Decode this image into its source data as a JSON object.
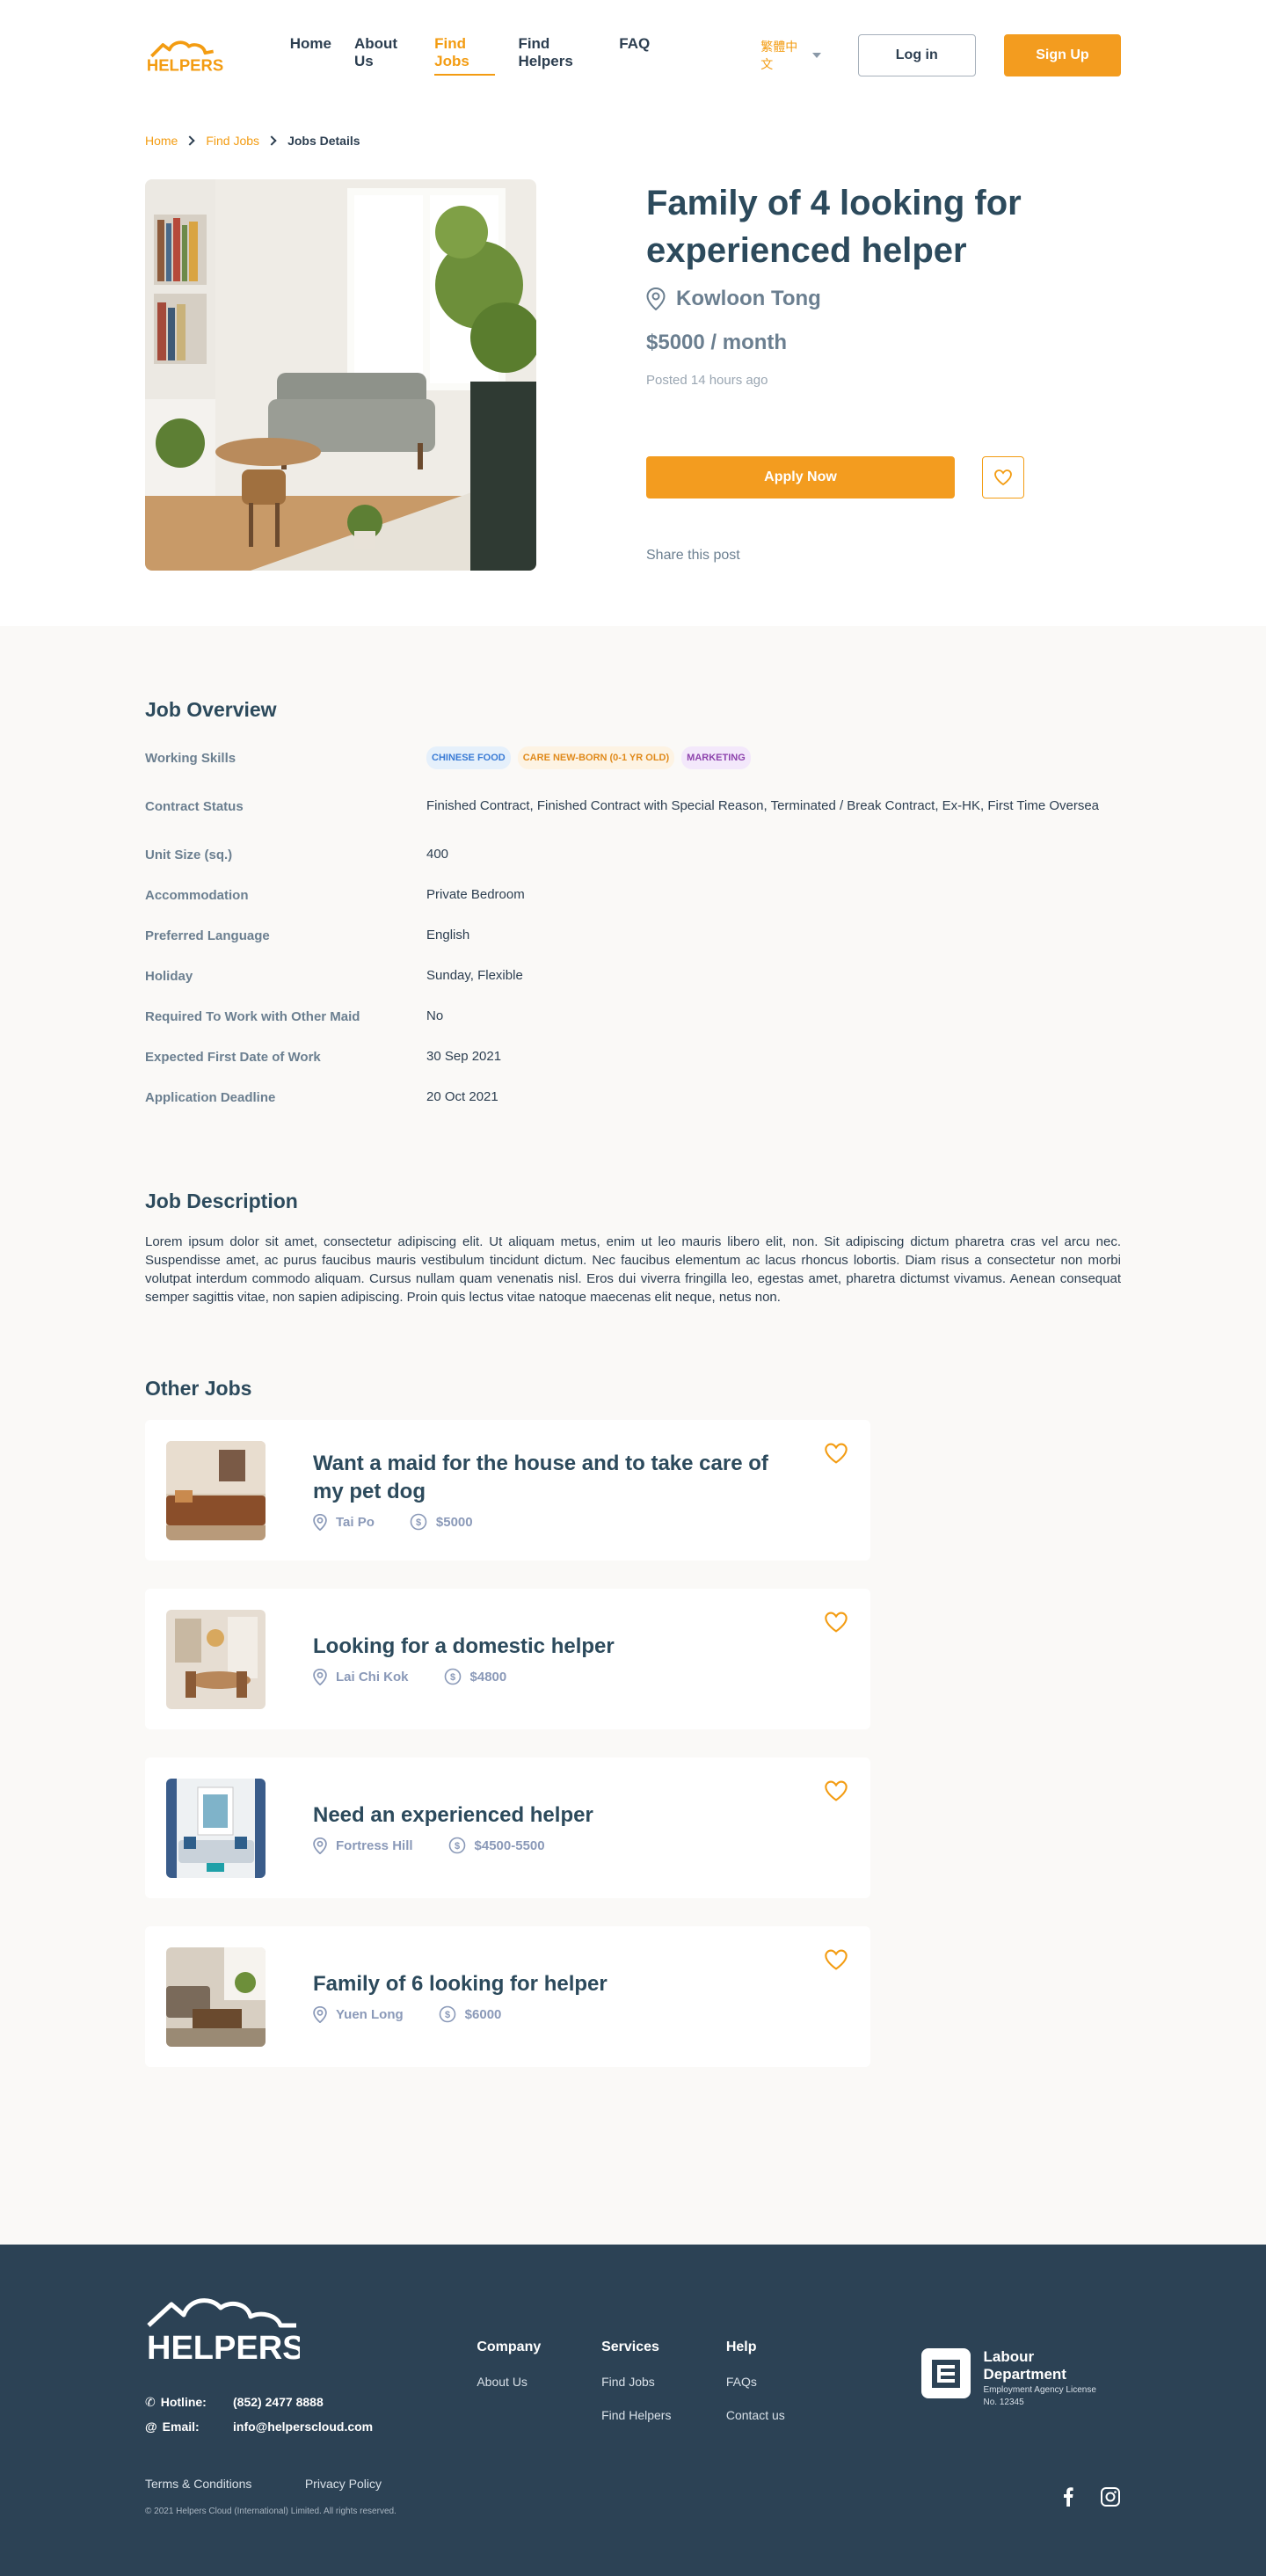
{
  "header": {
    "nav": [
      {
        "label": "Home",
        "active": false
      },
      {
        "label": "About Us",
        "active": false
      },
      {
        "label": "Find Jobs",
        "active": true
      },
      {
        "label": "Find Helpers",
        "active": false
      },
      {
        "label": "FAQ",
        "active": false
      }
    ],
    "language": "繁體中文",
    "login_label": "Log in",
    "signup_label": "Sign Up"
  },
  "breadcrumb": [
    "Home",
    "Find Jobs",
    "Jobs Details"
  ],
  "job": {
    "title": "Family of 4 looking for experienced helper",
    "location": "Kowloon Tong",
    "salary": "$5000 / month",
    "posted": "Posted 14 hours ago",
    "apply_label": "Apply Now",
    "share_label": "Share this post"
  },
  "overview": {
    "title": "Job Overview",
    "skills_label": "Working Skills",
    "skills": [
      "CHINESE FOOD",
      "CARE NEW-BORN (0-1 YR OLD)",
      "MARKETING"
    ],
    "rows": [
      {
        "label": "Contract Status",
        "value": "Finished Contract, Finished Contract with Special Reason, Terminated / Break Contract, Ex-HK, First Time Oversea"
      },
      {
        "label": "Unit Size (sq.)",
        "value": "400"
      },
      {
        "label": "Accommodation",
        "value": "Private Bedroom"
      },
      {
        "label": "Preferred Language",
        "value": "English"
      },
      {
        "label": "Holiday",
        "value": "Sunday, Flexible"
      },
      {
        "label": "Required To Work with Other Maid",
        "value": "No"
      },
      {
        "label": "Expected First Date of Work",
        "value": "30 Sep 2021"
      },
      {
        "label": "Application Deadline",
        "value": "20 Oct 2021"
      }
    ]
  },
  "description": {
    "title": "Job Description",
    "text": "Lorem ipsum dolor sit amet, consectetur adipiscing elit. Ut aliquam metus, enim ut leo mauris libero elit, non. Sit adipiscing dictum pharetra cras vel arcu nec. Suspendisse amet, ac purus faucibus mauris vestibulum tincidunt dictum. Nec faucibus elementum ac lacus rhoncus lobortis. Diam risus a consectetur non morbi volutpat interdum commodo aliquam. Cursus nullam quam venenatis nisl. Eros dui viverra fringilla leo, egestas amet, pharetra dictumst vivamus. Aenean consequat semper sagittis vitae, non sapien adipiscing. Proin quis lectus vitae natoque maecenas elit neque, netus non."
  },
  "other_jobs": {
    "title": "Other Jobs",
    "items": [
      {
        "title": "Want a maid for the house and to take care of my pet dog",
        "location": "Tai Po",
        "salary": "$5000"
      },
      {
        "title": "Looking for a domestic helper",
        "location": "Lai Chi Kok",
        "salary": "$4800"
      },
      {
        "title": "Need an experienced helper",
        "location": "Fortress Hill",
        "salary": "$4500-5500"
      },
      {
        "title": "Family of 6 looking for helper",
        "location": "Yuen Long",
        "salary": "$6000"
      }
    ]
  },
  "footer": {
    "hotline_label": "Hotline:",
    "hotline": "(852) 2477 8888",
    "email_label": "Email:",
    "email": "info@helperscloud.com",
    "columns": [
      {
        "title": "Company",
        "links": [
          "About Us"
        ]
      },
      {
        "title": "Services",
        "links": [
          "Find Jobs",
          "Find Helpers"
        ]
      },
      {
        "title": "Help",
        "links": [
          "FAQs",
          "Contact us"
        ]
      }
    ],
    "labour_title": "Labour Department",
    "labour_sub1": "Employment Agency License",
    "labour_sub2": "No. 12345",
    "terms": "Terms & Conditions",
    "privacy": "Privacy Policy",
    "copyright": "© 2021 Helpers Cloud (International) Limited. All rights reserved."
  },
  "colors": {
    "accent": "#f39c1f",
    "heading": "#2c4a5c",
    "footer_bg": "#2c4255"
  }
}
